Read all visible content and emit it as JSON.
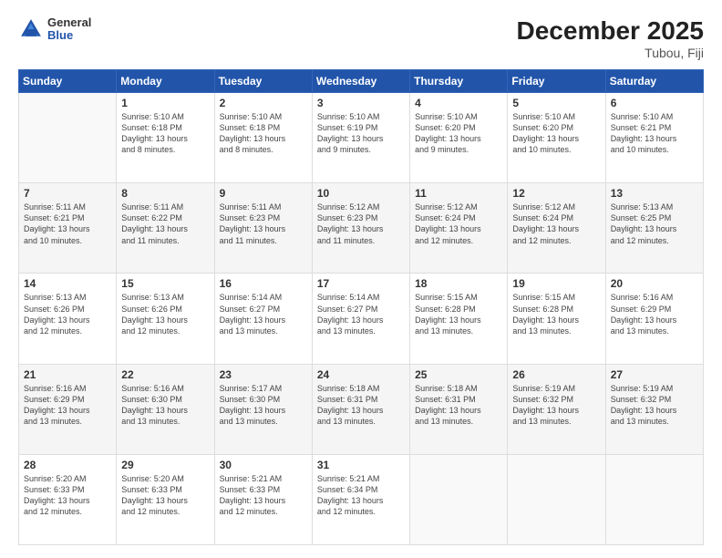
{
  "header": {
    "logo_general": "General",
    "logo_blue": "Blue",
    "title": "December 2025",
    "subtitle": "Tubou, Fiji"
  },
  "weekdays": [
    "Sunday",
    "Monday",
    "Tuesday",
    "Wednesday",
    "Thursday",
    "Friday",
    "Saturday"
  ],
  "weeks": [
    [
      {
        "day": "",
        "info": ""
      },
      {
        "day": "1",
        "info": "Sunrise: 5:10 AM\nSunset: 6:18 PM\nDaylight: 13 hours\nand 8 minutes."
      },
      {
        "day": "2",
        "info": "Sunrise: 5:10 AM\nSunset: 6:18 PM\nDaylight: 13 hours\nand 8 minutes."
      },
      {
        "day": "3",
        "info": "Sunrise: 5:10 AM\nSunset: 6:19 PM\nDaylight: 13 hours\nand 9 minutes."
      },
      {
        "day": "4",
        "info": "Sunrise: 5:10 AM\nSunset: 6:20 PM\nDaylight: 13 hours\nand 9 minutes."
      },
      {
        "day": "5",
        "info": "Sunrise: 5:10 AM\nSunset: 6:20 PM\nDaylight: 13 hours\nand 10 minutes."
      },
      {
        "day": "6",
        "info": "Sunrise: 5:10 AM\nSunset: 6:21 PM\nDaylight: 13 hours\nand 10 minutes."
      }
    ],
    [
      {
        "day": "7",
        "info": "Sunrise: 5:11 AM\nSunset: 6:21 PM\nDaylight: 13 hours\nand 10 minutes."
      },
      {
        "day": "8",
        "info": "Sunrise: 5:11 AM\nSunset: 6:22 PM\nDaylight: 13 hours\nand 11 minutes."
      },
      {
        "day": "9",
        "info": "Sunrise: 5:11 AM\nSunset: 6:23 PM\nDaylight: 13 hours\nand 11 minutes."
      },
      {
        "day": "10",
        "info": "Sunrise: 5:12 AM\nSunset: 6:23 PM\nDaylight: 13 hours\nand 11 minutes."
      },
      {
        "day": "11",
        "info": "Sunrise: 5:12 AM\nSunset: 6:24 PM\nDaylight: 13 hours\nand 12 minutes."
      },
      {
        "day": "12",
        "info": "Sunrise: 5:12 AM\nSunset: 6:24 PM\nDaylight: 13 hours\nand 12 minutes."
      },
      {
        "day": "13",
        "info": "Sunrise: 5:13 AM\nSunset: 6:25 PM\nDaylight: 13 hours\nand 12 minutes."
      }
    ],
    [
      {
        "day": "14",
        "info": "Sunrise: 5:13 AM\nSunset: 6:26 PM\nDaylight: 13 hours\nand 12 minutes."
      },
      {
        "day": "15",
        "info": "Sunrise: 5:13 AM\nSunset: 6:26 PM\nDaylight: 13 hours\nand 12 minutes."
      },
      {
        "day": "16",
        "info": "Sunrise: 5:14 AM\nSunset: 6:27 PM\nDaylight: 13 hours\nand 13 minutes."
      },
      {
        "day": "17",
        "info": "Sunrise: 5:14 AM\nSunset: 6:27 PM\nDaylight: 13 hours\nand 13 minutes."
      },
      {
        "day": "18",
        "info": "Sunrise: 5:15 AM\nSunset: 6:28 PM\nDaylight: 13 hours\nand 13 minutes."
      },
      {
        "day": "19",
        "info": "Sunrise: 5:15 AM\nSunset: 6:28 PM\nDaylight: 13 hours\nand 13 minutes."
      },
      {
        "day": "20",
        "info": "Sunrise: 5:16 AM\nSunset: 6:29 PM\nDaylight: 13 hours\nand 13 minutes."
      }
    ],
    [
      {
        "day": "21",
        "info": "Sunrise: 5:16 AM\nSunset: 6:29 PM\nDaylight: 13 hours\nand 13 minutes."
      },
      {
        "day": "22",
        "info": "Sunrise: 5:16 AM\nSunset: 6:30 PM\nDaylight: 13 hours\nand 13 minutes."
      },
      {
        "day": "23",
        "info": "Sunrise: 5:17 AM\nSunset: 6:30 PM\nDaylight: 13 hours\nand 13 minutes."
      },
      {
        "day": "24",
        "info": "Sunrise: 5:18 AM\nSunset: 6:31 PM\nDaylight: 13 hours\nand 13 minutes."
      },
      {
        "day": "25",
        "info": "Sunrise: 5:18 AM\nSunset: 6:31 PM\nDaylight: 13 hours\nand 13 minutes."
      },
      {
        "day": "26",
        "info": "Sunrise: 5:19 AM\nSunset: 6:32 PM\nDaylight: 13 hours\nand 13 minutes."
      },
      {
        "day": "27",
        "info": "Sunrise: 5:19 AM\nSunset: 6:32 PM\nDaylight: 13 hours\nand 13 minutes."
      }
    ],
    [
      {
        "day": "28",
        "info": "Sunrise: 5:20 AM\nSunset: 6:33 PM\nDaylight: 13 hours\nand 12 minutes."
      },
      {
        "day": "29",
        "info": "Sunrise: 5:20 AM\nSunset: 6:33 PM\nDaylight: 13 hours\nand 12 minutes."
      },
      {
        "day": "30",
        "info": "Sunrise: 5:21 AM\nSunset: 6:33 PM\nDaylight: 13 hours\nand 12 minutes."
      },
      {
        "day": "31",
        "info": "Sunrise: 5:21 AM\nSunset: 6:34 PM\nDaylight: 13 hours\nand 12 minutes."
      },
      {
        "day": "",
        "info": ""
      },
      {
        "day": "",
        "info": ""
      },
      {
        "day": "",
        "info": ""
      }
    ]
  ]
}
